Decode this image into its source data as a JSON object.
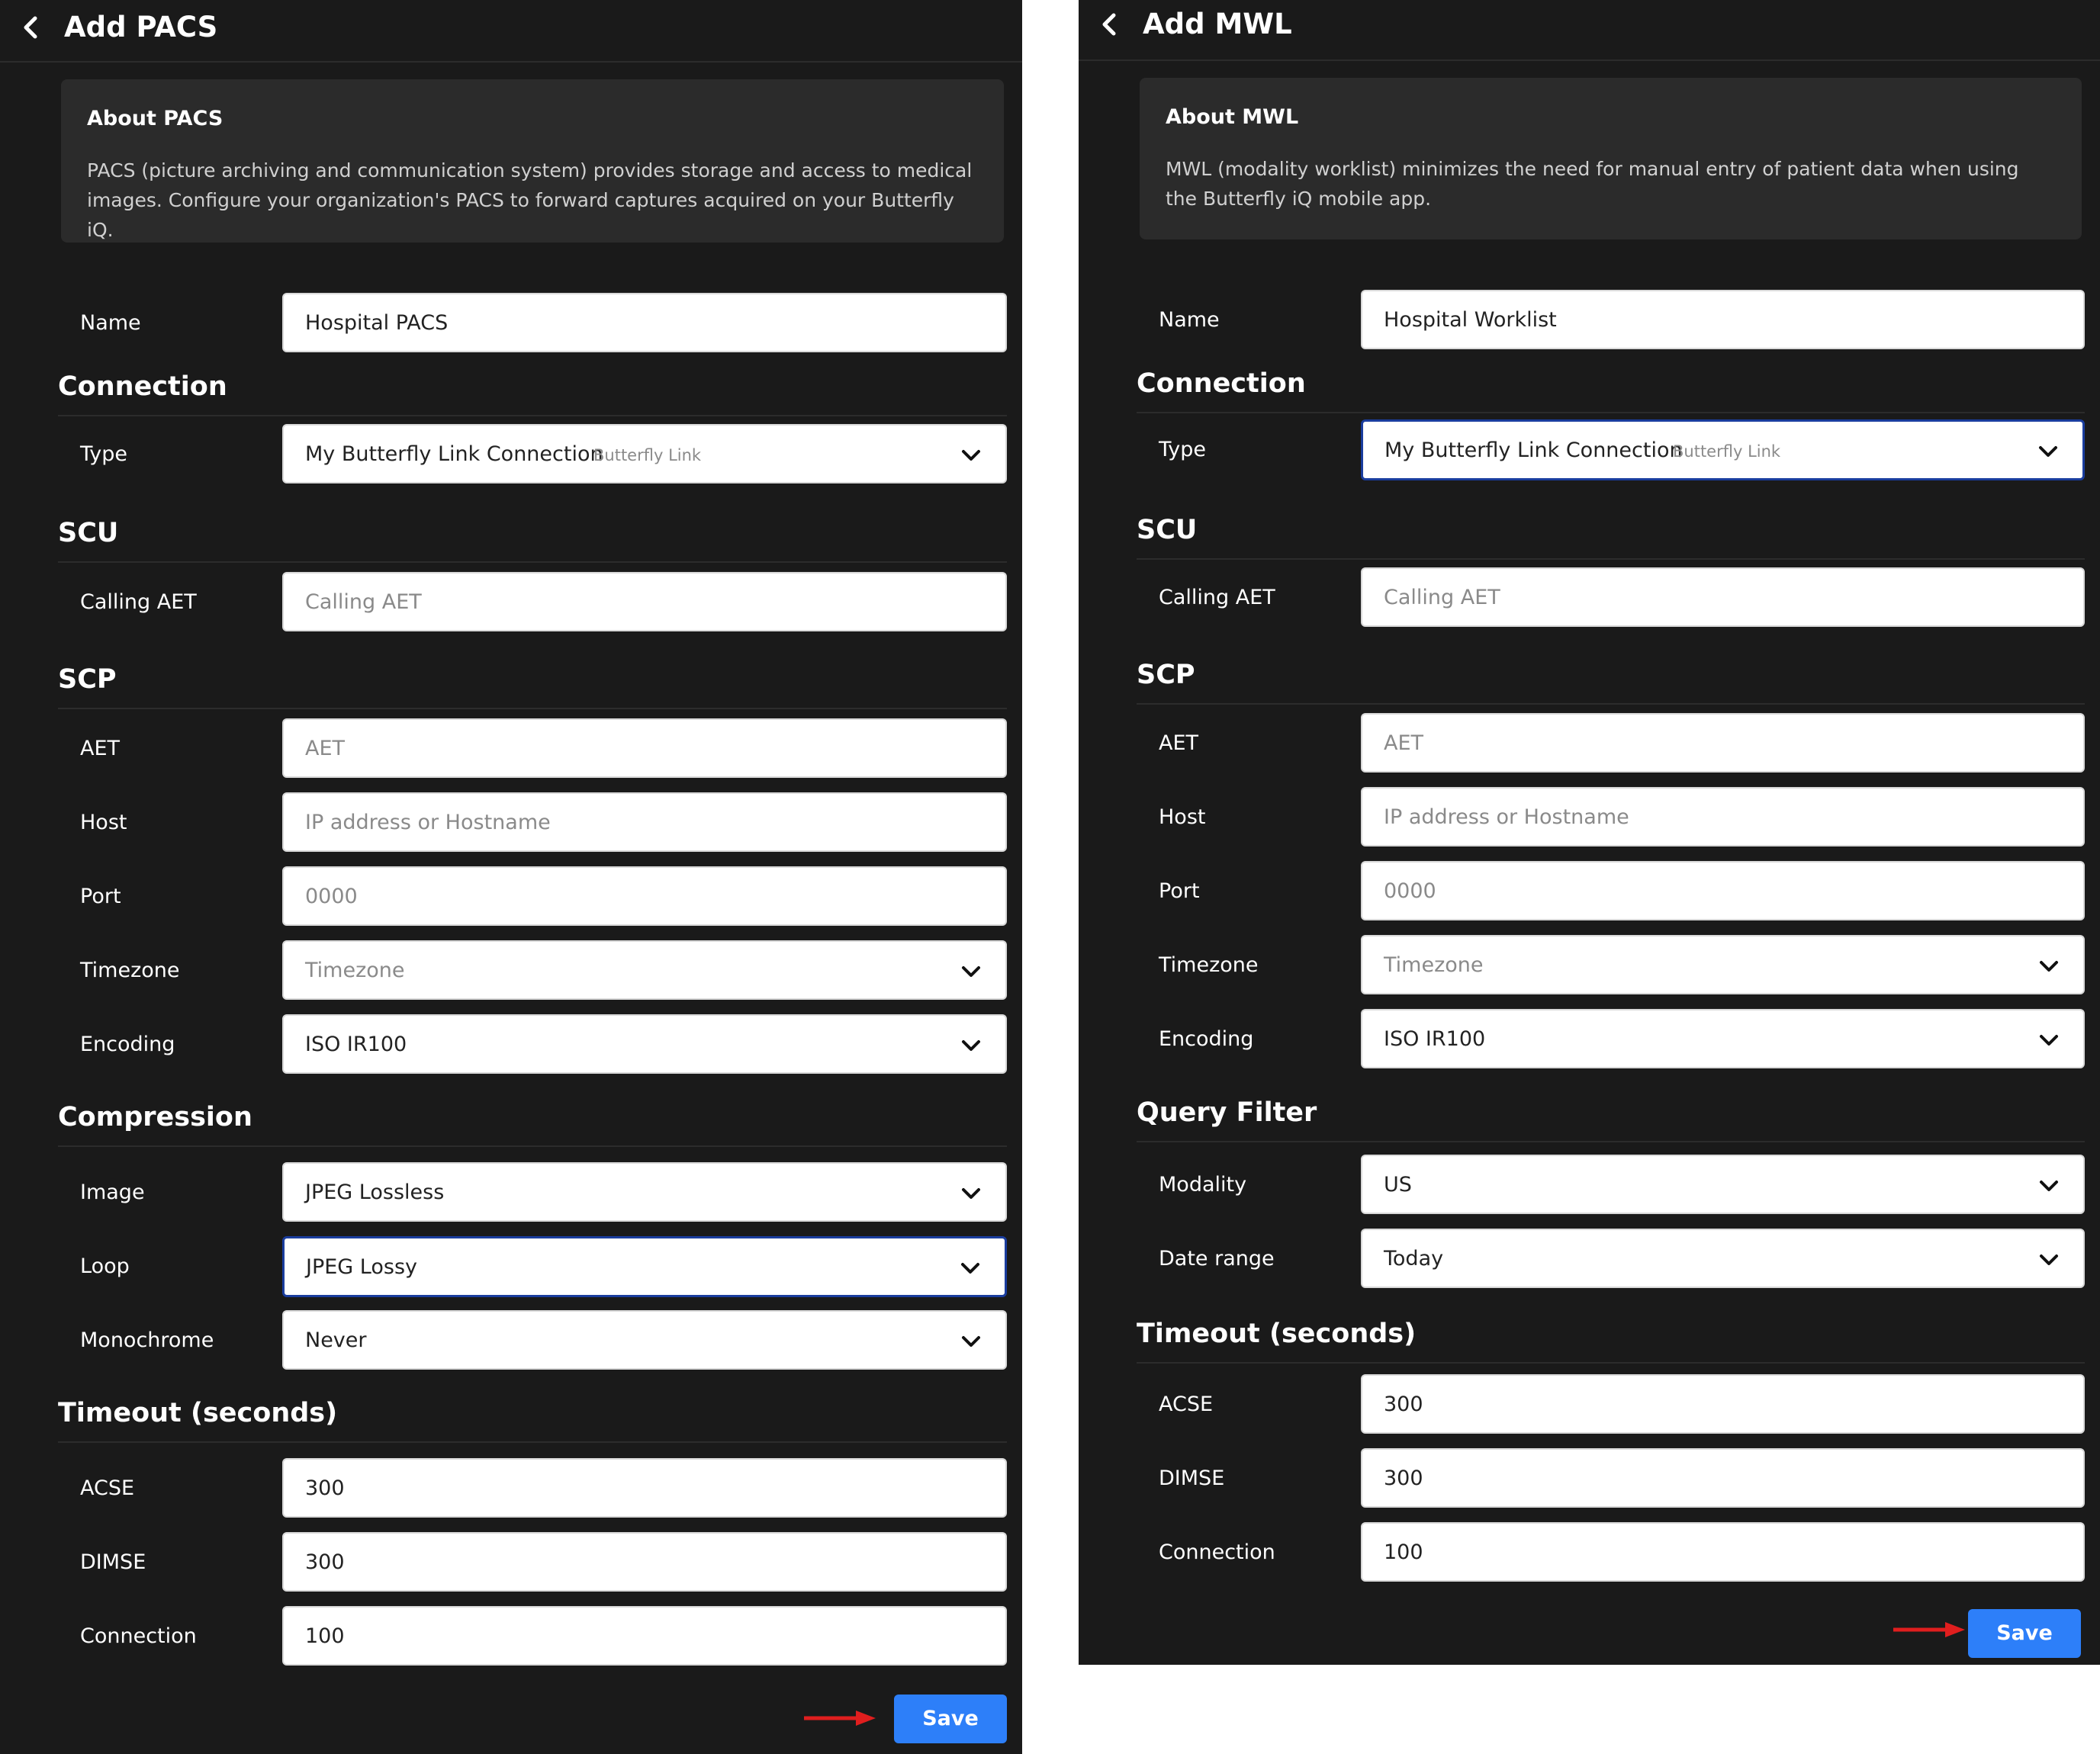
{
  "colors": {
    "panel_bg": "#1a1a1a",
    "about_bg": "#2b2b2b",
    "save_button": "#2d7ff9",
    "focus_border": "#1a3d9e",
    "annotation_arrow": "#e01e1e"
  },
  "icons": {
    "back": "chevron-left-icon",
    "dropdown": "chevron-down-icon",
    "annotation": "red-arrow-icon"
  },
  "pacs": {
    "title": "Add PACS",
    "about_title": "About PACS",
    "about_text": "PACS (picture archiving and communication system) provides storage and access to medical images. Configure your organization's PACS to forward captures acquired on your Butterfly iQ.",
    "name": {
      "label": "Name",
      "value": "Hospital PACS"
    },
    "connection_section": "Connection",
    "type": {
      "label": "Type",
      "value": "My Butterfly Link Connection",
      "tag": "Butterfly Link"
    },
    "scu_section": "SCU",
    "calling_aet": {
      "label": "Calling AET",
      "placeholder": "Calling AET"
    },
    "scp_section": "SCP",
    "aet": {
      "label": "AET",
      "placeholder": "AET"
    },
    "host": {
      "label": "Host",
      "placeholder": "IP address or Hostname"
    },
    "port": {
      "label": "Port",
      "placeholder": "0000"
    },
    "timezone": {
      "label": "Timezone",
      "placeholder": "Timezone"
    },
    "encoding": {
      "label": "Encoding",
      "value": "ISO IR100"
    },
    "compression_section": "Compression",
    "image": {
      "label": "Image",
      "value": "JPEG Lossless"
    },
    "loop": {
      "label": "Loop",
      "value": "JPEG Lossy"
    },
    "monochrome": {
      "label": "Monochrome",
      "value": "Never"
    },
    "timeout_section": "Timeout (seconds)",
    "acse": {
      "label": "ACSE",
      "value": "300"
    },
    "dimse": {
      "label": "DIMSE",
      "value": "300"
    },
    "connection": {
      "label": "Connection",
      "value": "100"
    },
    "save_label": "Save"
  },
  "mwl": {
    "title": "Add MWL",
    "about_title": "About MWL",
    "about_text": "MWL (modality worklist) minimizes the need for manual entry of patient data when using the Butterfly iQ mobile app.",
    "name": {
      "label": "Name",
      "value": "Hospital Worklist"
    },
    "connection_section": "Connection",
    "type": {
      "label": "Type",
      "value": "My Butterfly Link Connection",
      "tag": "Butterfly Link"
    },
    "scu_section": "SCU",
    "calling_aet": {
      "label": "Calling AET",
      "placeholder": "Calling AET"
    },
    "scp_section": "SCP",
    "aet": {
      "label": "AET",
      "placeholder": "AET"
    },
    "host": {
      "label": "Host",
      "placeholder": "IP address or Hostname"
    },
    "port": {
      "label": "Port",
      "placeholder": "0000"
    },
    "timezone": {
      "label": "Timezone",
      "placeholder": "Timezone"
    },
    "encoding": {
      "label": "Encoding",
      "value": "ISO IR100"
    },
    "query_section": "Query Filter",
    "modality": {
      "label": "Modality",
      "value": "US"
    },
    "date_range": {
      "label": "Date range",
      "value": "Today"
    },
    "timeout_section": "Timeout (seconds)",
    "acse": {
      "label": "ACSE",
      "value": "300"
    },
    "dimse": {
      "label": "DIMSE",
      "value": "300"
    },
    "connection": {
      "label": "Connection",
      "value": "100"
    },
    "save_label": "Save"
  }
}
